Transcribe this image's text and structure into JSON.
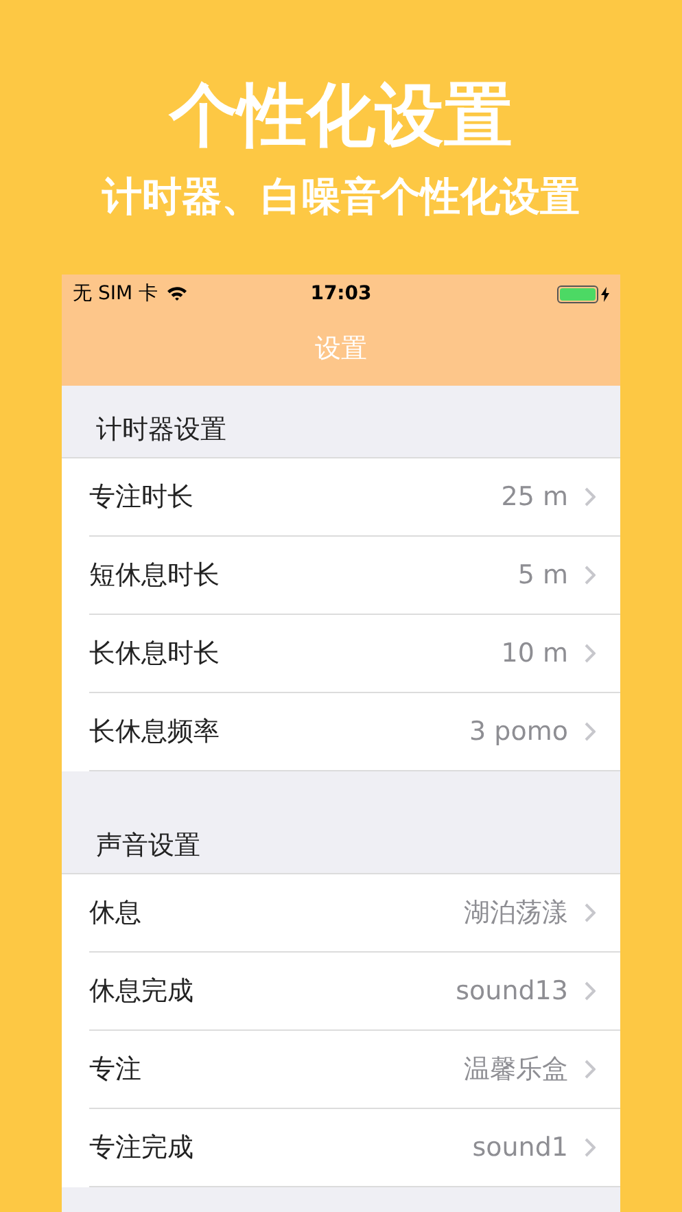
{
  "headline": "个性化设置",
  "subheadline": "计时器、白噪音个性化设置",
  "status_bar": {
    "carrier": "无 SIM 卡",
    "time": "17:03",
    "battery": {
      "level": 1,
      "charging": true
    }
  },
  "nav_bar": {
    "title": "设置"
  },
  "sections": [
    {
      "title": "计时器设置",
      "rows": [
        {
          "label": "专注时长",
          "value": "25 m"
        },
        {
          "label": "短休息时长",
          "value": "5 m"
        },
        {
          "label": "长休息时长",
          "value": "10 m"
        },
        {
          "label": "长休息频率",
          "value": "3 pomo"
        }
      ]
    },
    {
      "title": "声音设置",
      "rows": [
        {
          "label": "休息",
          "value": "湖泊荡漾"
        },
        {
          "label": "休息完成",
          "value": "sound13"
        },
        {
          "label": "专注",
          "value": "温馨乐盒"
        },
        {
          "label": "专注完成",
          "value": "sound1"
        }
      ]
    }
  ]
}
